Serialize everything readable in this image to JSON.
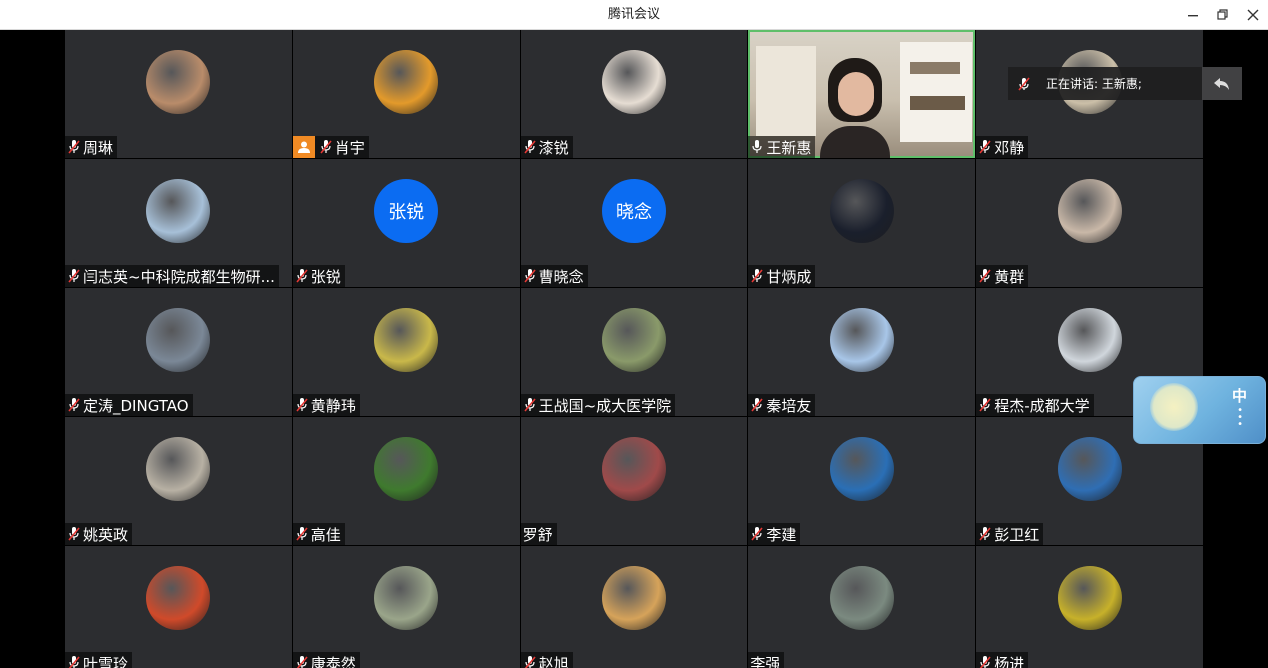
{
  "window": {
    "title": "腾讯会议"
  },
  "speaking_indicator": {
    "text": "正在讲话: 王新惠;"
  },
  "ime": {
    "lang": "中"
  },
  "participants": [
    {
      "name": "周琳",
      "avatar": "photo-girl-red-coat",
      "avatar_color": "#b98c6a",
      "muted": true
    },
    {
      "name": "肖宇",
      "avatar": "photo-garfield",
      "avatar_color": "#e39a2b",
      "muted": true,
      "host": true
    },
    {
      "name": "漆锐",
      "avatar": "photo-child",
      "avatar_color": "#e6ddd3",
      "muted": true
    },
    {
      "name": "王新惠",
      "avatar": "video",
      "muted": false,
      "speaking": true
    },
    {
      "name": "邓静",
      "avatar": "photo-cup",
      "avatar_color": "#cbbfa8",
      "muted": true
    },
    {
      "name": "闫志英~中科院成都生物研...",
      "avatar": "photo-boy",
      "avatar_color": "#a7c0d8",
      "muted": true
    },
    {
      "name": "张锐",
      "avatar": "initials",
      "initials": "张锐",
      "muted": true
    },
    {
      "name": "曹晓念",
      "avatar": "initials",
      "initials": "晓念",
      "muted": true
    },
    {
      "name": "甘炳成",
      "avatar": "photo-mushroom",
      "avatar_color": "#1a1f2c",
      "muted": true
    },
    {
      "name": "黄群",
      "avatar": "photo-grass",
      "avatar_color": "#c9b8a8",
      "muted": true
    },
    {
      "name": "定涛_DINGTAO",
      "avatar": "photo-glass",
      "avatar_color": "#7b8897",
      "muted": true
    },
    {
      "name": "黄静玮",
      "avatar": "photo-panda",
      "avatar_color": "#c9b84a",
      "muted": true
    },
    {
      "name": "王战国~成大医学院",
      "avatar": "photo-man-gate",
      "avatar_color": "#8a9a6a",
      "muted": true
    },
    {
      "name": "秦培友",
      "avatar": "photo-building",
      "avatar_color": "#a8c6e8",
      "muted": true
    },
    {
      "name": "程杰-成都大学",
      "avatar": "photo-sky-person",
      "avatar_color": "#d0d6dc",
      "muted": true
    },
    {
      "name": "姚英政",
      "avatar": "photo-fence",
      "avatar_color": "#b8b1a4",
      "muted": true
    },
    {
      "name": "高佳",
      "avatar": "photo-flower",
      "avatar_color": "#3f7a2e",
      "muted": true
    },
    {
      "name": "罗舒",
      "avatar": "photo-blossom",
      "avatar_color": "#a04a4a",
      "muted": false
    },
    {
      "name": "李建",
      "avatar": "photo-ball",
      "avatar_color": "#2a6fb6",
      "muted": true
    },
    {
      "name": "彭卫红",
      "avatar": "photo-sea",
      "avatar_color": "#2f6eb4",
      "muted": true
    },
    {
      "name": "叶雪玲",
      "avatar": "photo-cartoon",
      "avatar_color": "#d04a2a",
      "muted": true
    },
    {
      "name": "康泰然",
      "avatar": "photo-tree",
      "avatar_color": "#9aa58a",
      "muted": true
    },
    {
      "name": "赵旭",
      "avatar": "photo-bear",
      "avatar_color": "#d6a35a",
      "muted": true
    },
    {
      "name": "李强",
      "avatar": "photo-mountain",
      "avatar_color": "#7b8a80",
      "muted": false
    },
    {
      "name": "杨进",
      "avatar": "photo-rapeseed",
      "avatar_color": "#c7b12a",
      "muted": true
    }
  ]
}
